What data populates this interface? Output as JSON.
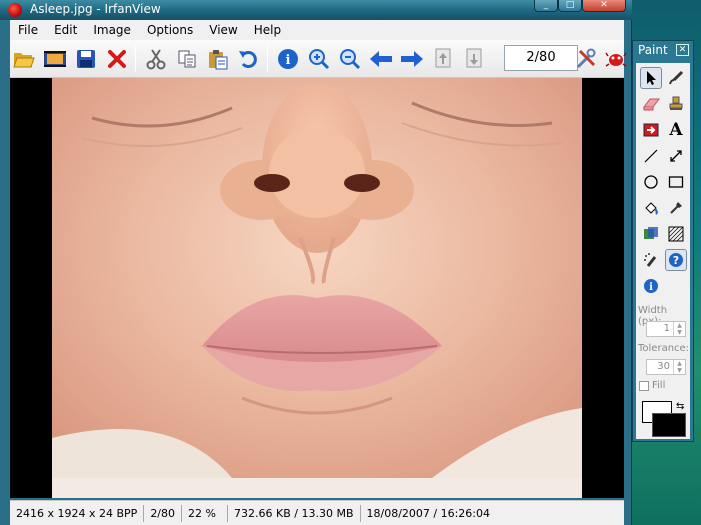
{
  "window": {
    "title": "Asleep.jpg - IrfanView",
    "minimize": "_",
    "maximize": "□",
    "close": "✕"
  },
  "menu": {
    "items": [
      "File",
      "Edit",
      "Image",
      "Options",
      "View",
      "Help"
    ]
  },
  "toolbar": {
    "buttons": [
      {
        "name": "open-icon"
      },
      {
        "name": "slideshow-icon"
      },
      {
        "name": "save-icon"
      },
      {
        "name": "delete-icon"
      },
      {
        "name": "cut-icon"
      },
      {
        "name": "copy-icon"
      },
      {
        "name": "paste-icon"
      },
      {
        "name": "undo-icon"
      },
      {
        "name": "info-icon"
      },
      {
        "name": "zoom-in-icon"
      },
      {
        "name": "zoom-out-icon"
      },
      {
        "name": "previous-icon"
      },
      {
        "name": "next-icon"
      },
      {
        "name": "first-page-icon"
      },
      {
        "name": "next-page-icon"
      },
      {
        "name": "settings-icon"
      },
      {
        "name": "irfanview-logo-icon"
      }
    ],
    "page_indicator": "2/80"
  },
  "image": {
    "filename": "Asleep.jpg",
    "subject": "close-up of a sleeping baby's face"
  },
  "status": {
    "dimensions": "2416 x 1924 x 24 BPP",
    "page": "2/80",
    "zoom": "22 %",
    "size": "732.66 KB / 13.30 MB",
    "datetime": "18/08/2007 / 16:26:04"
  },
  "paint": {
    "title": "Paint",
    "close": "✕",
    "text_tool": "A",
    "width_label": "Width (px):",
    "width_value": "1",
    "tolerance_label": "Tolerance:",
    "tolerance_value": "30",
    "fill_label": "Fill",
    "colors": {
      "foreground": "#000000",
      "background": "#ffffff"
    }
  },
  "colors": {
    "titlebar": "#1f6a83",
    "accent_blue": "#1e64c8",
    "delete_red": "#d21a1a"
  }
}
